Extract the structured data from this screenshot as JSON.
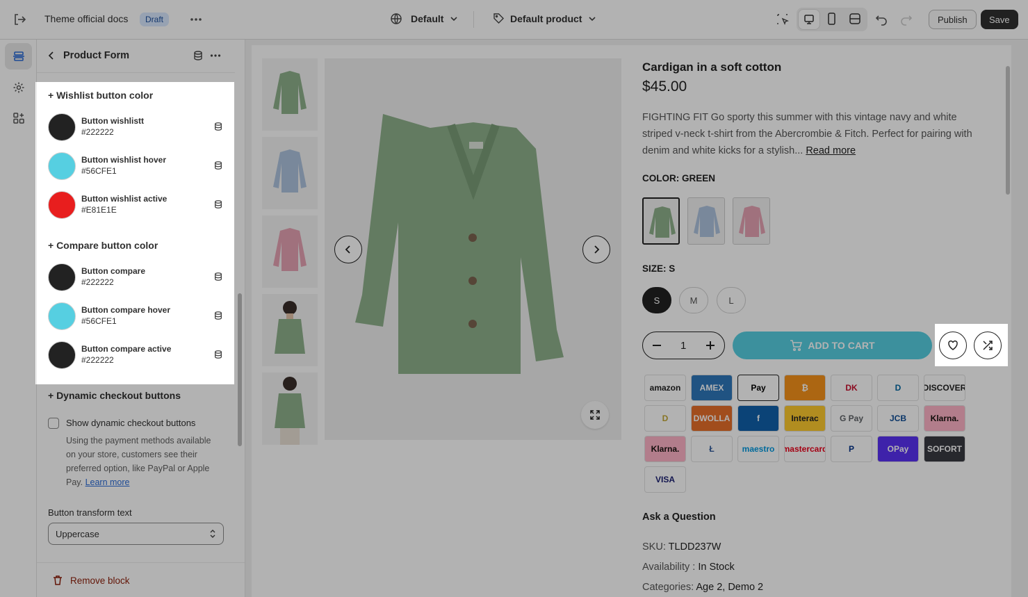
{
  "topbar": {
    "store_name": "Theme official docs",
    "status_badge": "Draft",
    "theme_selector": "Default",
    "template_selector": "Default product",
    "publish_label": "Publish",
    "save_label": "Save"
  },
  "panel": {
    "title": "Product Form",
    "wishlist_section": "+ Wishlist button color",
    "wishlist_colors": [
      {
        "name": "Button wishlistt",
        "value": "#222222",
        "color": "#222222"
      },
      {
        "name": "Button wishlist hover",
        "value": "#56CFE1",
        "color": "#56CFE1"
      },
      {
        "name": "Button wishlist active",
        "value": "#E81E1E",
        "color": "#E81E1E"
      }
    ],
    "compare_section": "+ Compare button color",
    "compare_colors": [
      {
        "name": "Button compare",
        "value": "#222222",
        "color": "#222222"
      },
      {
        "name": "Button compare hover",
        "value": "#56CFE1",
        "color": "#56CFE1"
      },
      {
        "name": "Button compare active",
        "value": "#222222",
        "color": "#222222"
      }
    ],
    "dynamic_section": "+ Dynamic checkout buttons",
    "dynamic_checkbox_label": "Show dynamic checkout buttons",
    "dynamic_help": "Using the payment methods available on your store, customers see their preferred option, like PayPal or Apple Pay.",
    "learn_more": "Learn more",
    "transform_label": "Button transform text",
    "transform_value": "Uppercase",
    "remove_block": "Remove block"
  },
  "product": {
    "title": "Cardigan in a soft cotton",
    "price": "$45.00",
    "description": "FIGHTING FIT Go sporty this summer with this vintage navy and white striped v-neck t-shirt from the Abercrombie & Fitch. Perfect for pairing with denim and white kicks for a stylish...",
    "read_more": "Read more",
    "color_label": "COLOR: GREEN",
    "size_label": "SIZE: S",
    "sizes": [
      "S",
      "M",
      "L"
    ],
    "quantity": "1",
    "add_to_cart": "ADD TO CART",
    "payment_methods": [
      "amazon",
      "AMEX",
      "Pay",
      "₿",
      "DK",
      "D",
      "DISCOVER",
      "D",
      "DWOLLA",
      "f",
      "Interac",
      "G Pay",
      "JCB",
      "Klarna.",
      "Klarna.",
      "Ł",
      "maestro",
      "mastercard",
      "P",
      "OPay",
      "SOFORT",
      "VISA"
    ],
    "ask_question": "Ask a Question",
    "sku_label": "SKU:",
    "sku_value": "TLDD237W",
    "availability_label": "Availability :",
    "availability_value": "In Stock",
    "categories_label": "Categories:",
    "categories_value": "Age 2, Demo 2"
  },
  "colors": {
    "accent": "#56CFE1",
    "sweater_green": "#8fb08c",
    "sweater_blue": "#aec3de",
    "sweater_pink": "#e6a3b3"
  }
}
